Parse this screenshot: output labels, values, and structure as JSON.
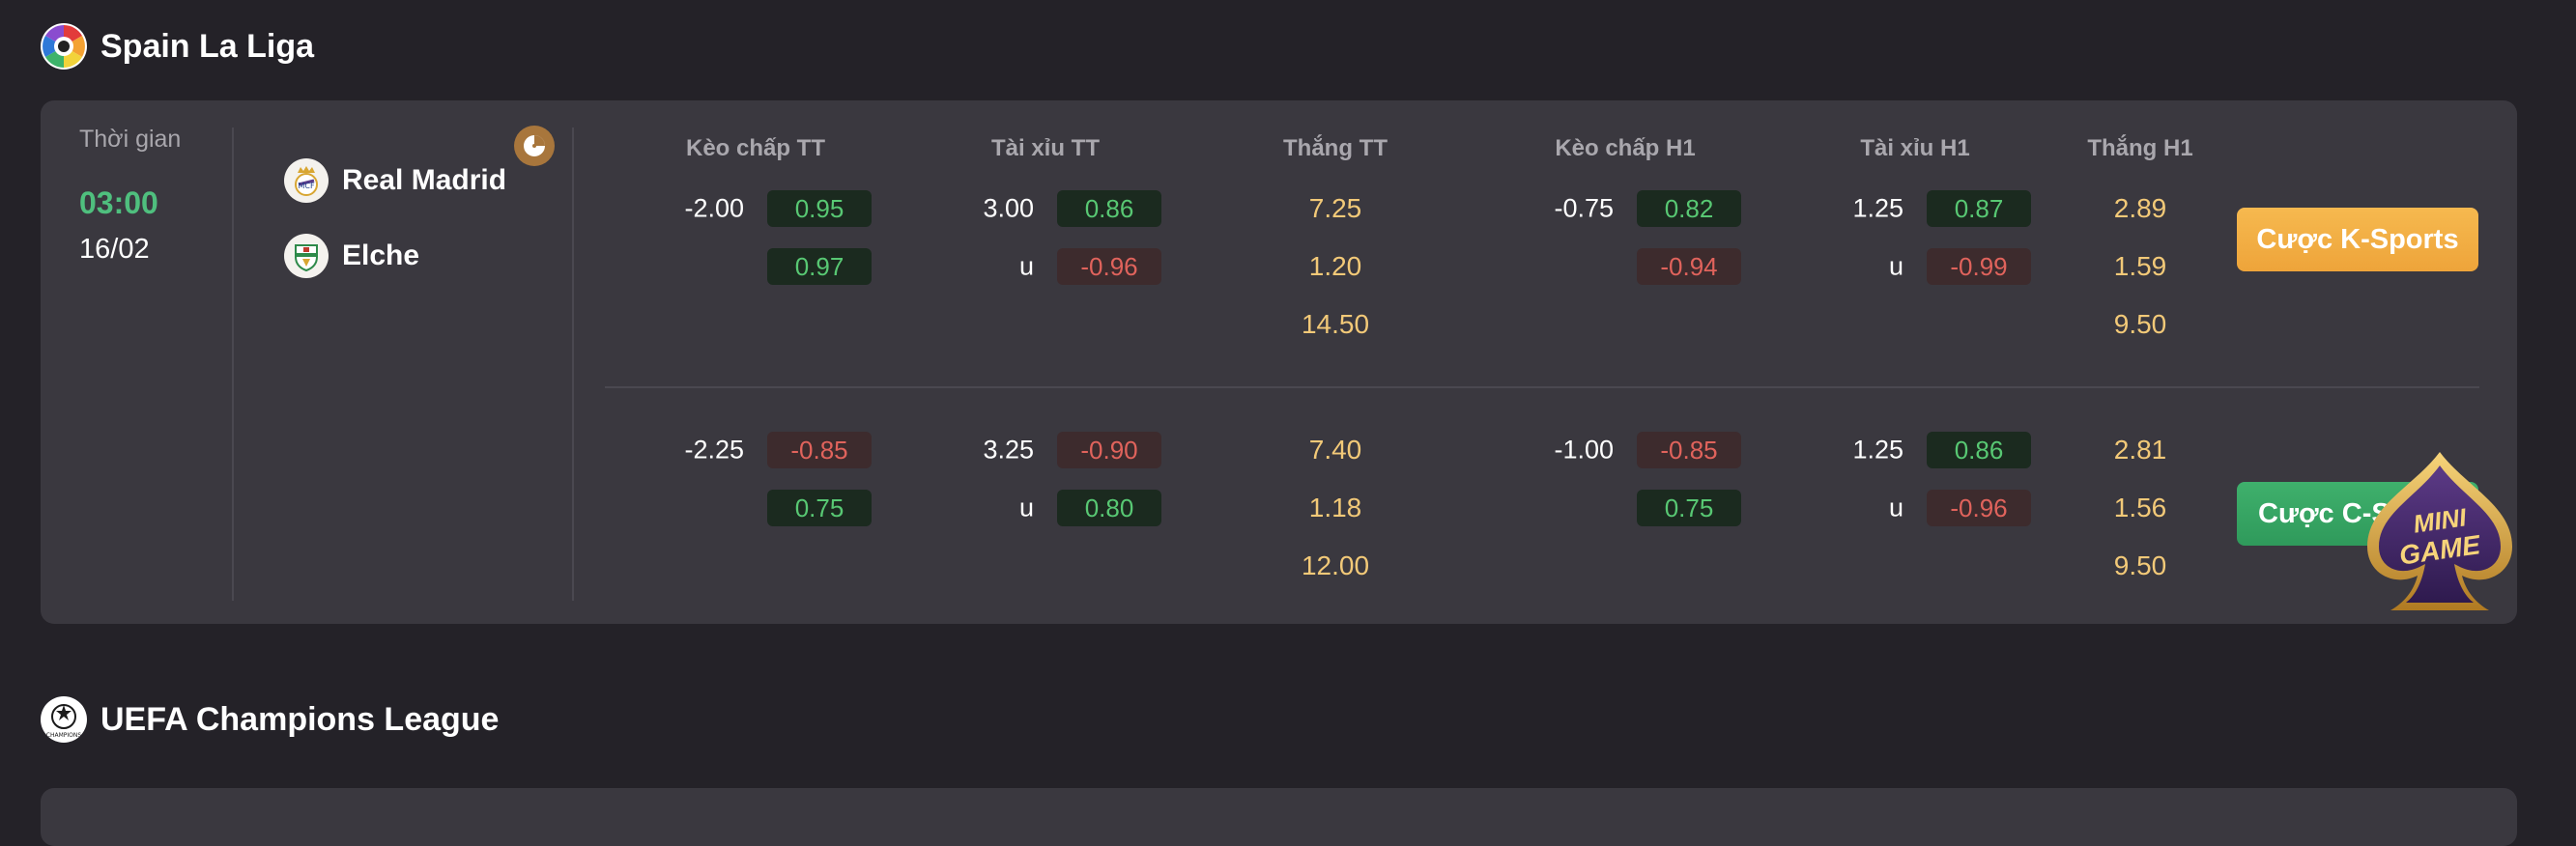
{
  "leagues": [
    {
      "name": "Spain La Liga",
      "icon": "laliga-logo-icon"
    },
    {
      "name": "UEFA Champions League",
      "icon": "ucl-logo-icon"
    }
  ],
  "match": {
    "time_label": "Thời gian",
    "time": "03:00",
    "date": "16/02",
    "home": {
      "name": "Real Madrid",
      "icon": "real-madrid-crest-icon"
    },
    "away": {
      "name": "Elche",
      "icon": "elche-crest-icon"
    },
    "stats_icon": "clock-chart-icon"
  },
  "columns": [
    "Kèo chấp TT",
    "Tài xỉu TT",
    "Thắng TT",
    "Kèo chấp H1",
    "Tài xỉu H1",
    "Thắng H1"
  ],
  "books": [
    {
      "button": "Cược K-Sports",
      "hcap_tt": {
        "line": "-2.00",
        "home": "0.95",
        "away": "0.97"
      },
      "ou_tt": {
        "line": "3.00",
        "under": "u",
        "over_odd": "0.86",
        "under_odd": "-0.96"
      },
      "win_tt": [
        "7.25",
        "1.20",
        "14.50"
      ],
      "hcap_h1": {
        "line": "-0.75",
        "home": "0.82",
        "away": "-0.94"
      },
      "ou_h1": {
        "line": "1.25",
        "under": "u",
        "over_odd": "0.87",
        "under_odd": "-0.99"
      },
      "win_h1": [
        "2.89",
        "1.59",
        "9.50"
      ]
    },
    {
      "button": "Cược C-Sports",
      "hcap_tt": {
        "line": "-2.25",
        "home": "-0.85",
        "away": "0.75"
      },
      "ou_tt": {
        "line": "3.25",
        "under": "u",
        "over_odd": "-0.90",
        "under_odd": "0.80"
      },
      "win_tt": [
        "7.40",
        "1.18",
        "12.00"
      ],
      "hcap_h1": {
        "line": "-1.00",
        "home": "-0.85",
        "away": "0.75"
      },
      "ou_h1": {
        "line": "1.25",
        "under": "u",
        "over_odd": "0.86",
        "under_odd": "-0.96"
      },
      "win_h1": [
        "2.81",
        "1.56",
        "9.50"
      ]
    }
  ],
  "mini_game": {
    "line1": "MINI",
    "line2": "GAME"
  },
  "colors": {
    "accent_green": "#4fbf7e",
    "odd_positive": "#58c873",
    "odd_negative": "#e0635c",
    "win_gold": "#f2c978",
    "k_sports_button": "#f6b94f",
    "c_sports_button": "#3fb06c"
  }
}
